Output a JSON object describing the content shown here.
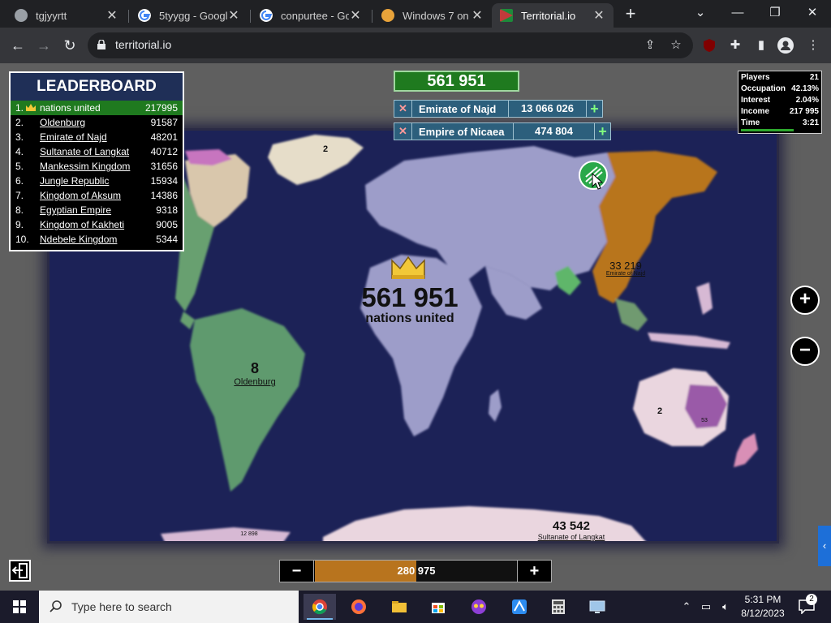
{
  "browser": {
    "tabs": [
      {
        "title": "tgjyyrtt",
        "close": "✕"
      },
      {
        "title": "5tyygg - Google",
        "close": "✕"
      },
      {
        "title": "conpurtee - Goo",
        "close": "✕"
      },
      {
        "title": "Windows 7 on S",
        "close": "✕"
      },
      {
        "title": "Territorial.io",
        "close": "✕"
      }
    ],
    "new_tab": "+",
    "url": "territorial.io",
    "window": {
      "chevron": "⌄",
      "minimize": "—",
      "restore": "❐",
      "close": "✕"
    },
    "nav": {
      "back": "←",
      "forward": "→",
      "reload": "↻"
    }
  },
  "game": {
    "leaderboard": {
      "title": "LEADERBOARD",
      "rows": [
        {
          "rank": "1.",
          "name": "nations united",
          "value": "217995"
        },
        {
          "rank": "2.",
          "name": "Oldenburg",
          "value": "91587"
        },
        {
          "rank": "3.",
          "name": "Emirate of Najd",
          "value": "48201"
        },
        {
          "rank": "4.",
          "name": "Sultanate of Langkat",
          "value": "40712"
        },
        {
          "rank": "5.",
          "name": "Mankessim Kingdom",
          "value": "31656"
        },
        {
          "rank": "6.",
          "name": "Jungle Republic",
          "value": "15934"
        },
        {
          "rank": "7.",
          "name": "Kingdom of Aksum",
          "value": "14386"
        },
        {
          "rank": "8.",
          "name": "Egyptian Empire",
          "value": "9318"
        },
        {
          "rank": "9.",
          "name": "Kingdom of Kakheti",
          "value": "9005"
        },
        {
          "rank": "10.",
          "name": "Ndebele Kingdom",
          "value": "5344"
        }
      ]
    },
    "top_score": "561 951",
    "targets": [
      {
        "x": "✕",
        "name": "Emirate of Najd",
        "value": "13 066 026",
        "plus": "+"
      },
      {
        "x": "✕",
        "name": "Empire of Nicaea",
        "value": "474 804",
        "plus": "+"
      }
    ],
    "stats": [
      {
        "key": "Players",
        "value": "21"
      },
      {
        "key": "Occupation",
        "value": "42.13%"
      },
      {
        "key": "Interest",
        "value": "2.04%"
      },
      {
        "key": "Income",
        "value": "217 995"
      },
      {
        "key": "Time",
        "value": "3:21"
      }
    ],
    "time_progress": 0.66,
    "map_labels": {
      "player_count": "561 951",
      "player_name": "nations united",
      "oldenburg_count": "8",
      "oldenburg_name": "Oldenburg",
      "najd_count": "33 219",
      "najd_name": "Emirate of Najd",
      "langkat_count": "43 542",
      "langkat_name": "Sultanate of Langkat",
      "north_count": "2",
      "australia_count": "2",
      "australia_small": "53",
      "south_small": "12 898"
    },
    "zoom": {
      "in": "+",
      "out": "−"
    },
    "attack": {
      "minus": "−",
      "plus": "+",
      "value": "280 975",
      "ratio": 0.5
    },
    "side_tab": "‹"
  },
  "taskbar": {
    "search_placeholder": "Type here to search",
    "time": "5:31 PM",
    "date": "8/12/2023",
    "tray_chevron": "⌃",
    "notifications": "2"
  },
  "colors": {
    "ocean": "#1c2257",
    "player": "#9d9dc9",
    "oldenburg": "#5e9a6e",
    "najd": "#b8741e",
    "langkat": "#ead6df",
    "leader_green": "#1f7a1f",
    "panel_blue": "#2c5f7c"
  }
}
